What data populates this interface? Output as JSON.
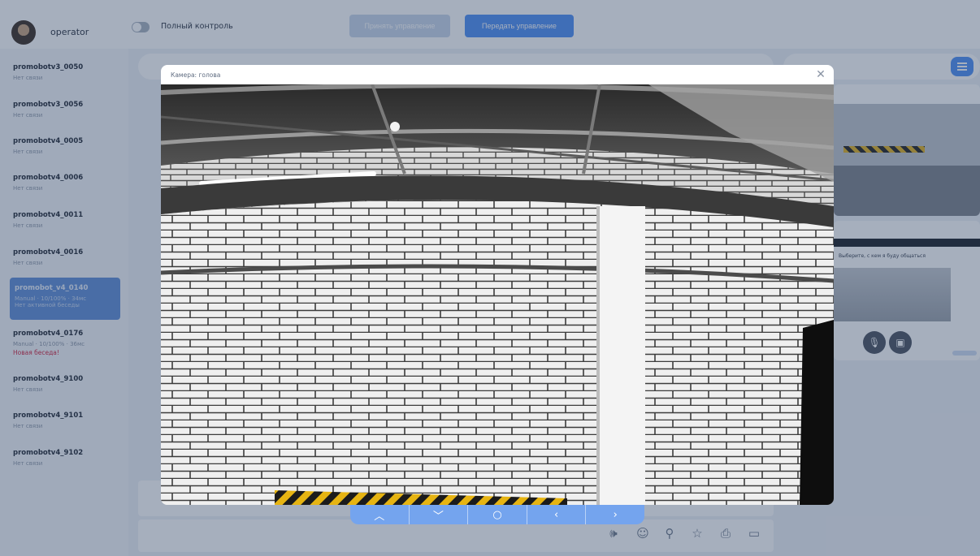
{
  "header": {
    "operator_name": "operator",
    "full_control_label": "Полный контроль",
    "full_control_on": false,
    "accept_control_label": "Принять управление",
    "transfer_control_label": "Передать управление"
  },
  "sidebar": {
    "robots": [
      {
        "name": "promobotv3_0050",
        "status": "Нет связи"
      },
      {
        "name": "promobotv3_0056",
        "status": "Нет связи"
      },
      {
        "name": "promobotv4_0005",
        "status": "Нет связи"
      },
      {
        "name": "promobotv4_0006",
        "status": "Нет связи"
      },
      {
        "name": "promobotv4_0011",
        "status": "Нет связи"
      },
      {
        "name": "promobotv4_0016",
        "status": "Нет связи"
      },
      {
        "name": "promobot_v4_0140",
        "status": "Manual · 10/100% · 34мс",
        "status2": "Нет активной беседы",
        "active": true
      },
      {
        "name": "promobotv4_0176",
        "status": "Manual · 10/100% · 36мс",
        "alert": "Новая беседа!"
      },
      {
        "name": "promobotv4_9100",
        "status": "Нет связи"
      },
      {
        "name": "promobotv4_9101",
        "status": "Нет связи"
      },
      {
        "name": "promobotv4_9102",
        "status": "Нет связи"
      }
    ]
  },
  "right_panel": {
    "screen_hint": "Выберите, с кем я буду общаться"
  },
  "modal": {
    "title": "Камера: голова",
    "close_icon": "close-icon"
  },
  "controls": [
    {
      "name": "arrow-up-icon",
      "glyph": "︿"
    },
    {
      "name": "arrow-down-icon",
      "glyph": "﹀"
    },
    {
      "name": "center-icon",
      "glyph": "○"
    },
    {
      "name": "arrow-left-icon",
      "glyph": "‹"
    },
    {
      "name": "arrow-right-icon",
      "glyph": "›"
    }
  ],
  "toolbar": {
    "icons": [
      "speaker-icon",
      "emoji-icon",
      "person-icon",
      "star-icon",
      "printer-icon",
      "screen-icon"
    ]
  },
  "colors": {
    "accent": "#4e8ff4",
    "overlay": "#2c4062",
    "alert": "#d21f3c"
  }
}
